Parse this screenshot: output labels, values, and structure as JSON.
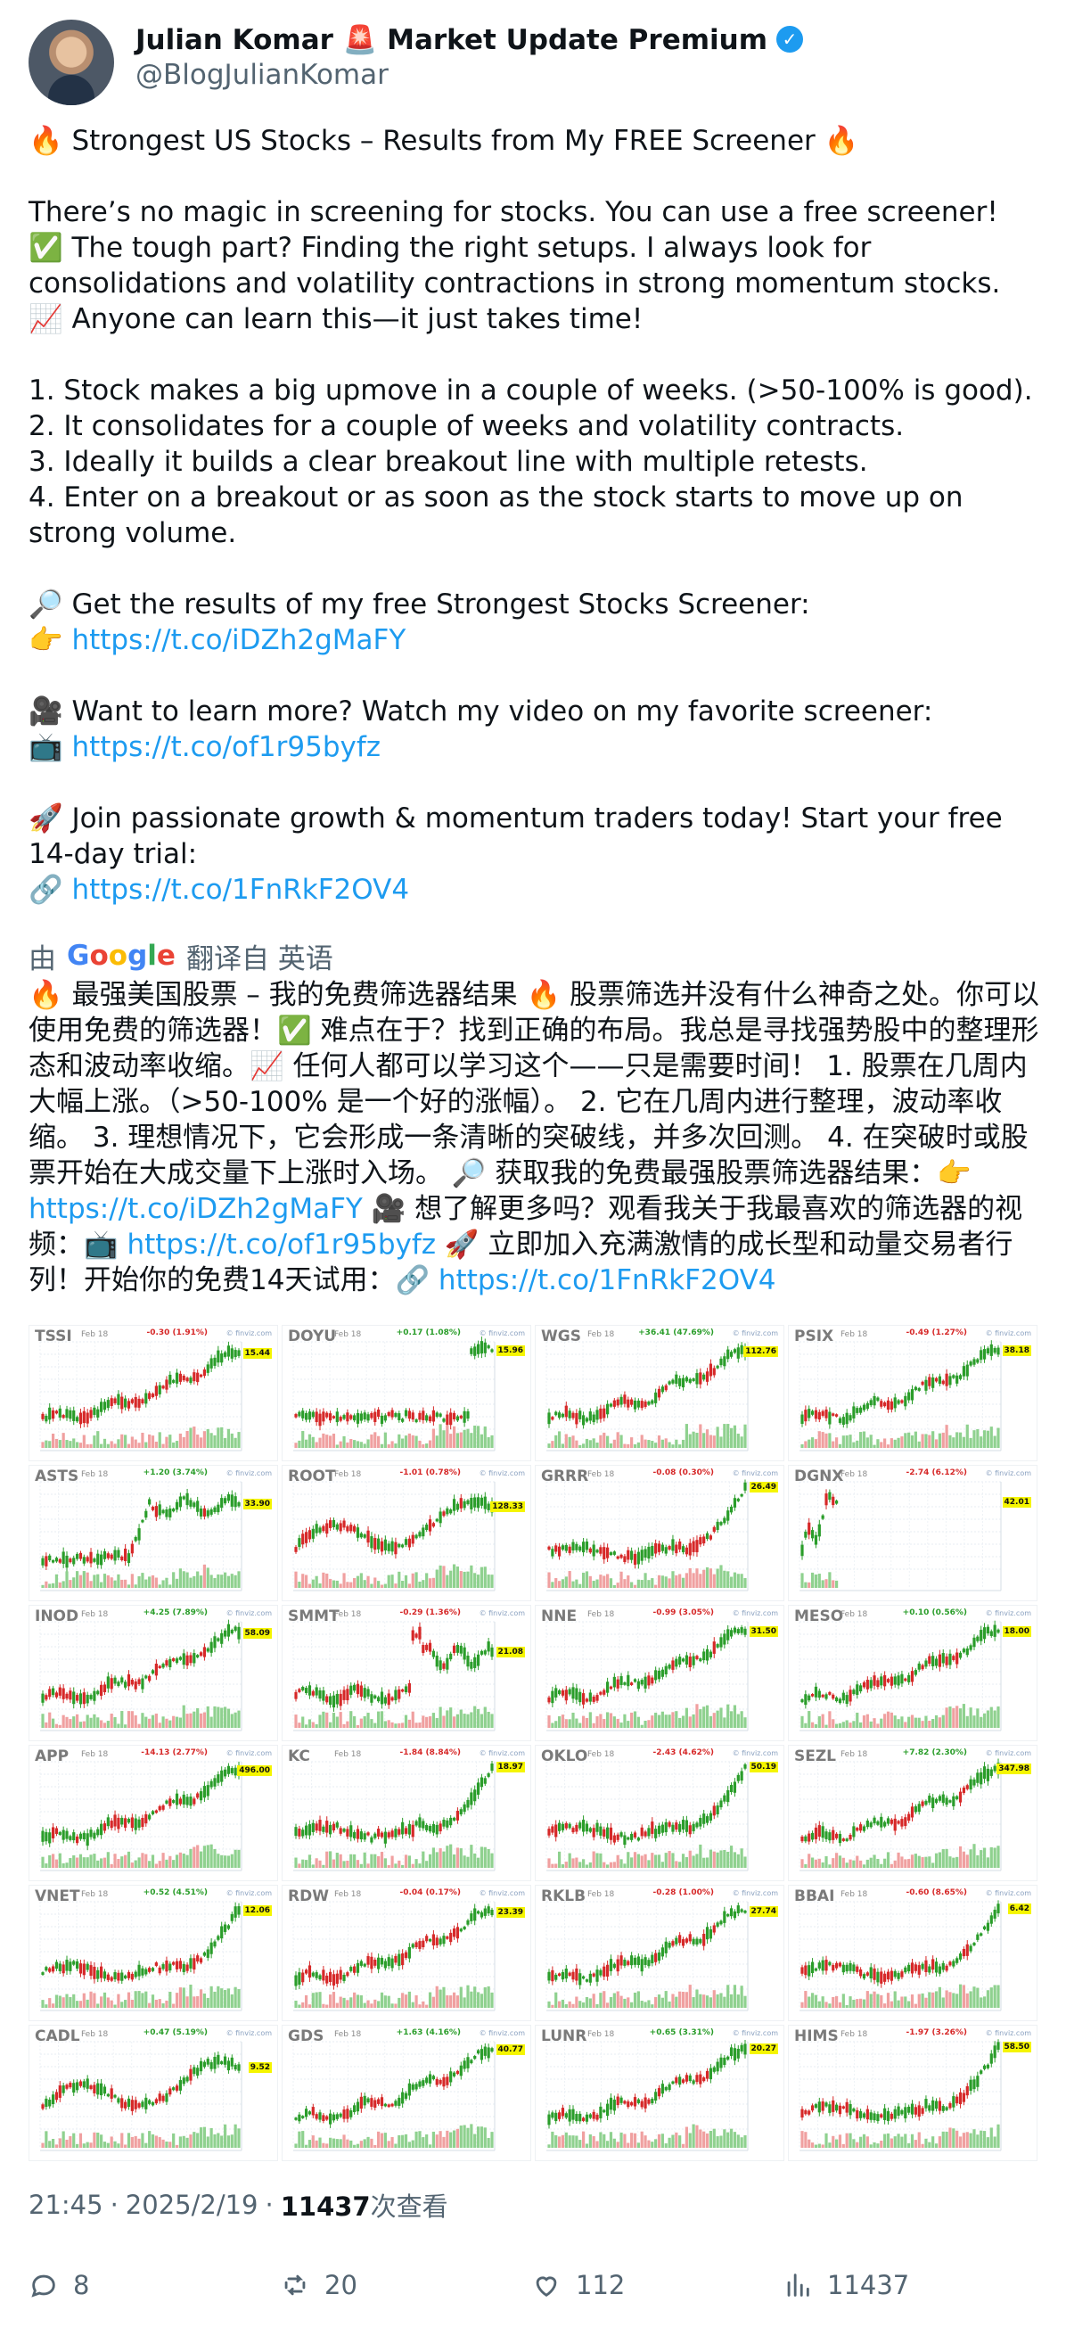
{
  "author": {
    "name": "Julian Komar 🚨 Market Update Premium",
    "handle": "@BlogJulianKomar",
    "verified_badge": "✓"
  },
  "tweet": {
    "heading": "🔥 Strongest US Stocks – Results from My FREE Screener 🔥",
    "intro": "There’s no magic in screening for stocks. You can use a free screener! ✅ The tough part? Finding the right setups. I always look for consolidations and volatility contractions in strong momentum stocks. 📈 Anyone can learn this—it just takes time!",
    "steps": [
      "1. Stock makes a big upmove in a couple of weeks. (>50-100% is good).",
      "2. It consolidates for a couple of weeks and volatility contracts.",
      "3. Ideally it builds a clear breakout line with multiple retests.",
      "4. Enter on a breakout or as soon as the stock starts to move up on strong volume."
    ],
    "screener_prompt": "🔎 Get the results of my free Strongest Stocks Screener:",
    "screener_prefix": "👉 ",
    "screener_link": "https://t.co/iDZh2gMaFY",
    "video_prompt": "🎥 Want to learn more? Watch my video on my favorite screener:",
    "video_prefix": "📺 ",
    "video_link": "https://t.co/of1r95byfz",
    "join_prompt": "🚀 Join passionate growth & momentum traders today! Start your free 14-day trial:",
    "join_prefix": "🔗 ",
    "join_link": "https://t.co/1FnRkF2OV4"
  },
  "translation": {
    "by": "由",
    "google": [
      "G",
      "o",
      "o",
      "g",
      "l",
      "e"
    ],
    "google_colors": [
      "#4285F4",
      "#EA4335",
      "#FBBC05",
      "#4285F4",
      "#34A853",
      "#EA4335"
    ],
    "from": "翻译自 英语",
    "text_part1": "🔥 最强美国股票 – 我的免费筛选器结果 🔥 股票筛选并没有什么神奇之处。你可以使用免费的筛选器！✅ 难点在于？找到正确的布局。我总是寻找强势股中的整理形态和波动率收缩。📈 任何人都可以学习这个——只是需要时间！ 1. 股票在几周内大幅上涨。（>50-100% 是一个好的涨幅）。 2. 它在几周内进行整理，波动率收缩。 3. 理想情况下，它会形成一条清晰的突破线，并多次回测。 4. 在突破时或股票开始在大成交量下上涨时入场。 🔎 获取我的免费最强股票筛选器结果：👉 ",
    "link1": "https://t.co/iDZh2gMaFY",
    "text_part2": " 🎥 想了解更多吗？观看我关于我最喜欢的筛选器的视频：📺 ",
    "link2": "https://t.co/of1r95byfz",
    "text_part3": " 🚀 立即加入充满激情的成长型和动量交易者行列！开始你的免费14天试用：🔗 ",
    "link3": "https://t.co/1FnRkF2OV4"
  },
  "charts": [
    {
      "ticker": "TSSI",
      "date": "Feb 18",
      "change": "-0.30 (1.91%)",
      "direction": "down",
      "price": "15.44",
      "source": "© finviz.com",
      "shape": "rise"
    },
    {
      "ticker": "DOYU",
      "date": "Feb 18",
      "change": "+0.17 (1.08%)",
      "direction": "up",
      "price": "15.96",
      "source": "© finviz.com",
      "shape": "spike"
    },
    {
      "ticker": "WGS",
      "date": "Feb 18",
      "change": "+36.41 (47.69%)",
      "direction": "up",
      "price": "112.76",
      "source": "© finviz.com",
      "shape": "rise"
    },
    {
      "ticker": "PSIX",
      "date": "Feb 18",
      "change": "-0.49 (1.27%)",
      "direction": "down",
      "price": "38.18",
      "source": "© finviz.com",
      "shape": "rise"
    },
    {
      "ticker": "ASTS",
      "date": "Feb 18",
      "change": "+1.20 (3.74%)",
      "direction": "up",
      "price": "33.90",
      "source": "© finviz.com",
      "shape": "midrise"
    },
    {
      "ticker": "ROOT",
      "date": "Feb 18",
      "change": "-1.01 (0.78%)",
      "direction": "down",
      "price": "128.33",
      "source": "© finviz.com",
      "shape": "wave"
    },
    {
      "ticker": "GRRR",
      "date": "Feb 18",
      "change": "-0.08 (0.30%)",
      "direction": "down",
      "price": "26.49",
      "source": "© finviz.com",
      "shape": "lateSpike"
    },
    {
      "ticker": "DGNX",
      "date": "Feb 18",
      "change": "-2.74 (6.12%)",
      "direction": "down",
      "price": "42.01",
      "source": "© finviz.com",
      "shape": "ipo"
    },
    {
      "ticker": "INOD",
      "date": "Feb 18",
      "change": "+4.25 (7.89%)",
      "direction": "up",
      "price": "58.09",
      "source": "© finviz.com",
      "shape": "rise"
    },
    {
      "ticker": "SMMT",
      "date": "Feb 18",
      "change": "-0.29 (1.36%)",
      "direction": "down",
      "price": "21.08",
      "source": "© finviz.com",
      "shape": "midSpike"
    },
    {
      "ticker": "NNE",
      "date": "Feb 18",
      "change": "-0.99 (3.05%)",
      "direction": "down",
      "price": "31.50",
      "source": "© finviz.com",
      "shape": "rise"
    },
    {
      "ticker": "MESO",
      "date": "Feb 18",
      "change": "+0.10 (0.56%)",
      "direction": "up",
      "price": "18.00",
      "source": "© finviz.com",
      "shape": "rise"
    },
    {
      "ticker": "APP",
      "date": "Feb 18",
      "change": "-14.13 (2.77%)",
      "direction": "down",
      "price": "496.00",
      "source": "© finviz.com",
      "shape": "rise"
    },
    {
      "ticker": "KC",
      "date": "Feb 18",
      "change": "-1.84 (8.84%)",
      "direction": "down",
      "price": "18.97",
      "source": "© finviz.com",
      "shape": "lateSpike"
    },
    {
      "ticker": "OKLO",
      "date": "Feb 18",
      "change": "-2.43 (4.62%)",
      "direction": "down",
      "price": "50.19",
      "source": "© finviz.com",
      "shape": "lateSpike"
    },
    {
      "ticker": "SEZL",
      "date": "Feb 18",
      "change": "+7.82 (2.30%)",
      "direction": "up",
      "price": "347.98",
      "source": "© finviz.com",
      "shape": "rise"
    },
    {
      "ticker": "VNET",
      "date": "Feb 18",
      "change": "+0.52 (4.51%)",
      "direction": "up",
      "price": "12.06",
      "source": "© finviz.com",
      "shape": "lateSpike"
    },
    {
      "ticker": "RDW",
      "date": "Feb 18",
      "change": "-0.04 (0.17%)",
      "direction": "down",
      "price": "23.39",
      "source": "© finviz.com",
      "shape": "rise"
    },
    {
      "ticker": "RKLB",
      "date": "Feb 18",
      "change": "-0.28 (1.00%)",
      "direction": "down",
      "price": "27.74",
      "source": "© finviz.com",
      "shape": "rise"
    },
    {
      "ticker": "BBAI",
      "date": "Feb 18",
      "change": "-0.60 (8.65%)",
      "direction": "down",
      "price": "6.42",
      "source": "© finviz.com",
      "shape": "lateSpike"
    },
    {
      "ticker": "CADL",
      "date": "Feb 18",
      "change": "+0.47 (5.19%)",
      "direction": "up",
      "price": "9.52",
      "source": "© finviz.com",
      "shape": "wave"
    },
    {
      "ticker": "GDS",
      "date": "Feb 18",
      "change": "+1.63 (4.16%)",
      "direction": "up",
      "price": "40.77",
      "source": "© finviz.com",
      "shape": "rise"
    },
    {
      "ticker": "LUNR",
      "date": "Feb 18",
      "change": "+0.65 (3.31%)",
      "direction": "up",
      "price": "20.27",
      "source": "© finviz.com",
      "shape": "rise"
    },
    {
      "ticker": "HIMS",
      "date": "Feb 18",
      "change": "-1.97 (3.26%)",
      "direction": "down",
      "price": "58.50",
      "source": "© finviz.com",
      "shape": "lateSpike"
    }
  ],
  "meta": {
    "time": "21:45",
    "date": "2025/2/19",
    "separator": "·",
    "views_count": "11437",
    "views_label": "次查看"
  },
  "actions": {
    "replies": "8",
    "reposts": "20",
    "likes": "112",
    "views": "11437"
  },
  "colors": {
    "link": "#1d9bf0",
    "muted": "#536471",
    "candle_up": "#2a9d2a",
    "candle_down": "#d62828",
    "price_tag": "#f5f500"
  }
}
